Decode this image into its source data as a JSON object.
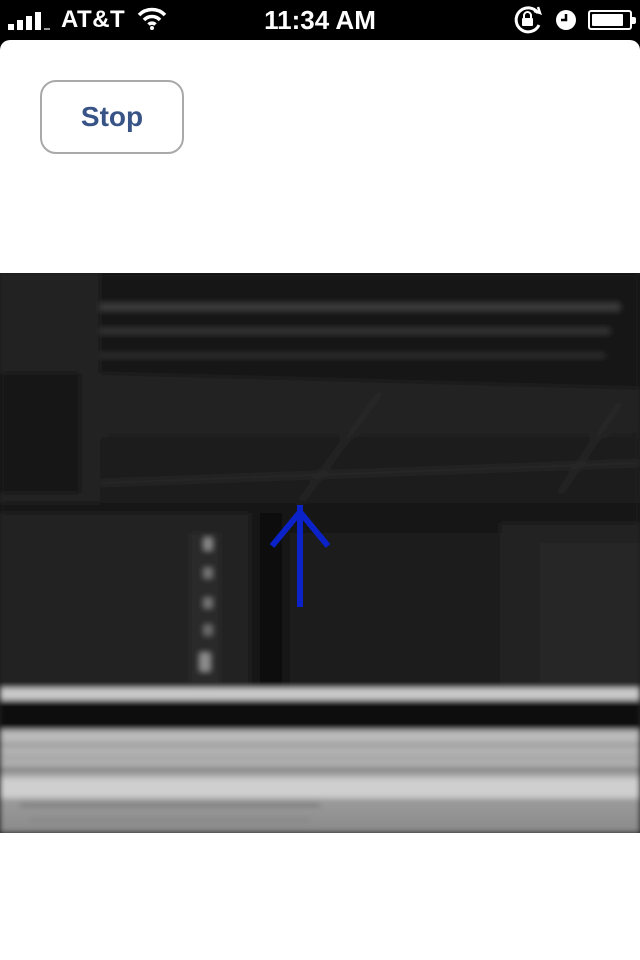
{
  "status_bar": {
    "carrier": "AT&T",
    "time": "11:34 AM",
    "signal_bars": 4,
    "icons": [
      "signal-bars-icon",
      "wifi-icon",
      "rotation-lock-icon",
      "alarm-clock-icon",
      "battery-icon"
    ],
    "battery_level": 0.85
  },
  "controls": {
    "stop_label": "Stop"
  },
  "camera": {
    "overlay_icon": "up-arrow-icon",
    "arrow_color": "#0a22c8"
  },
  "colors": {
    "button_text": "#385487",
    "button_border": "#a9a9a9"
  }
}
